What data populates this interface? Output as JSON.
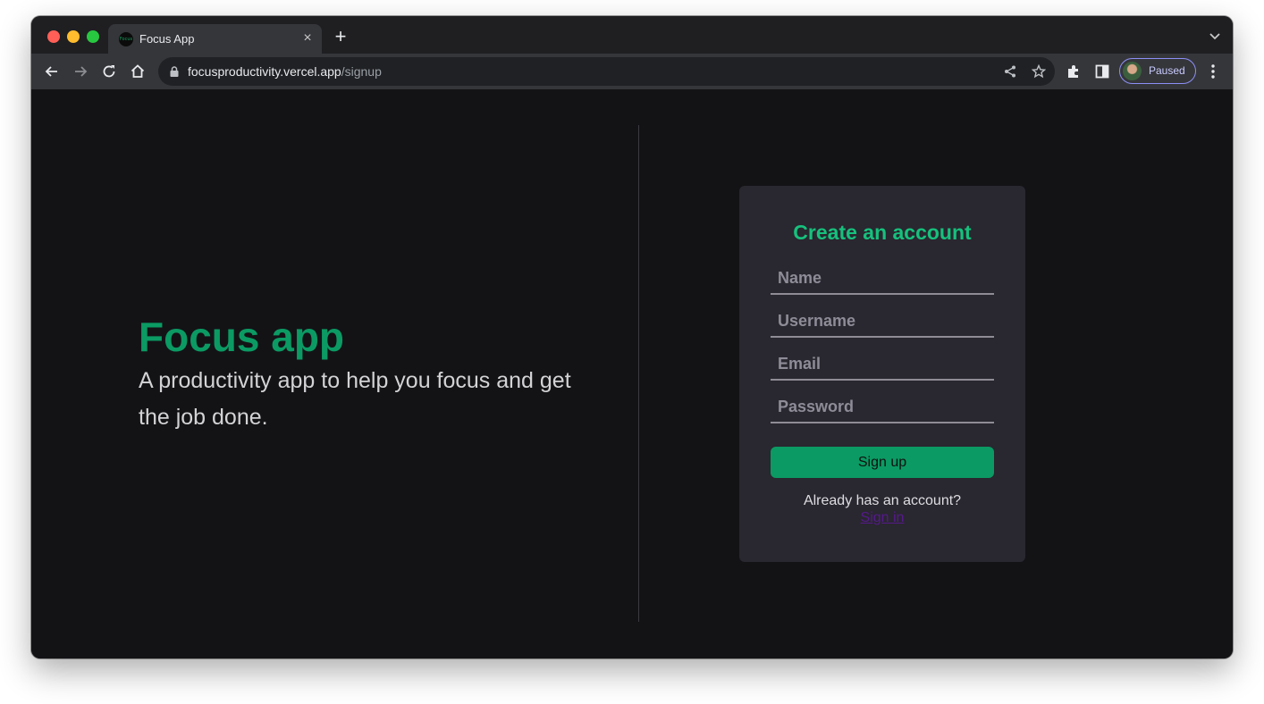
{
  "browser": {
    "tab": {
      "title": "Focus App",
      "favicon_text": "Focus",
      "close_glyph": "×"
    },
    "new_tab_glyph": "+",
    "url": {
      "host": "focusproductivity.vercel.app",
      "path": "/signup"
    },
    "profile": {
      "label": "Paused",
      "accent": "#8c8ff5"
    },
    "icons": [
      "back-icon",
      "forward-icon",
      "reload-icon",
      "home-icon",
      "lock-icon",
      "share-icon",
      "star-icon",
      "puzzle-icon",
      "side-panel-icon",
      "kebab-menu-icon",
      "tab-search-icon"
    ]
  },
  "hero": {
    "title": "Focus app",
    "subtitle": "A productivity app to help you focus and get the job done."
  },
  "signup": {
    "title": "Create an account",
    "fields": {
      "name": {
        "placeholder": "Name",
        "value": ""
      },
      "username": {
        "placeholder": "Username",
        "value": ""
      },
      "email": {
        "placeholder": "Email",
        "value": ""
      },
      "password": {
        "placeholder": "Password",
        "value": ""
      }
    },
    "submit_label": "Sign up",
    "already_text": "Already has an account?",
    "signin_label": "Sign in"
  },
  "colors": {
    "brand_green": "#0b9a63",
    "heading_green": "#16c17d",
    "page_bg": "#131316",
    "card_bg": "#29272f",
    "link": "#551a8b"
  }
}
